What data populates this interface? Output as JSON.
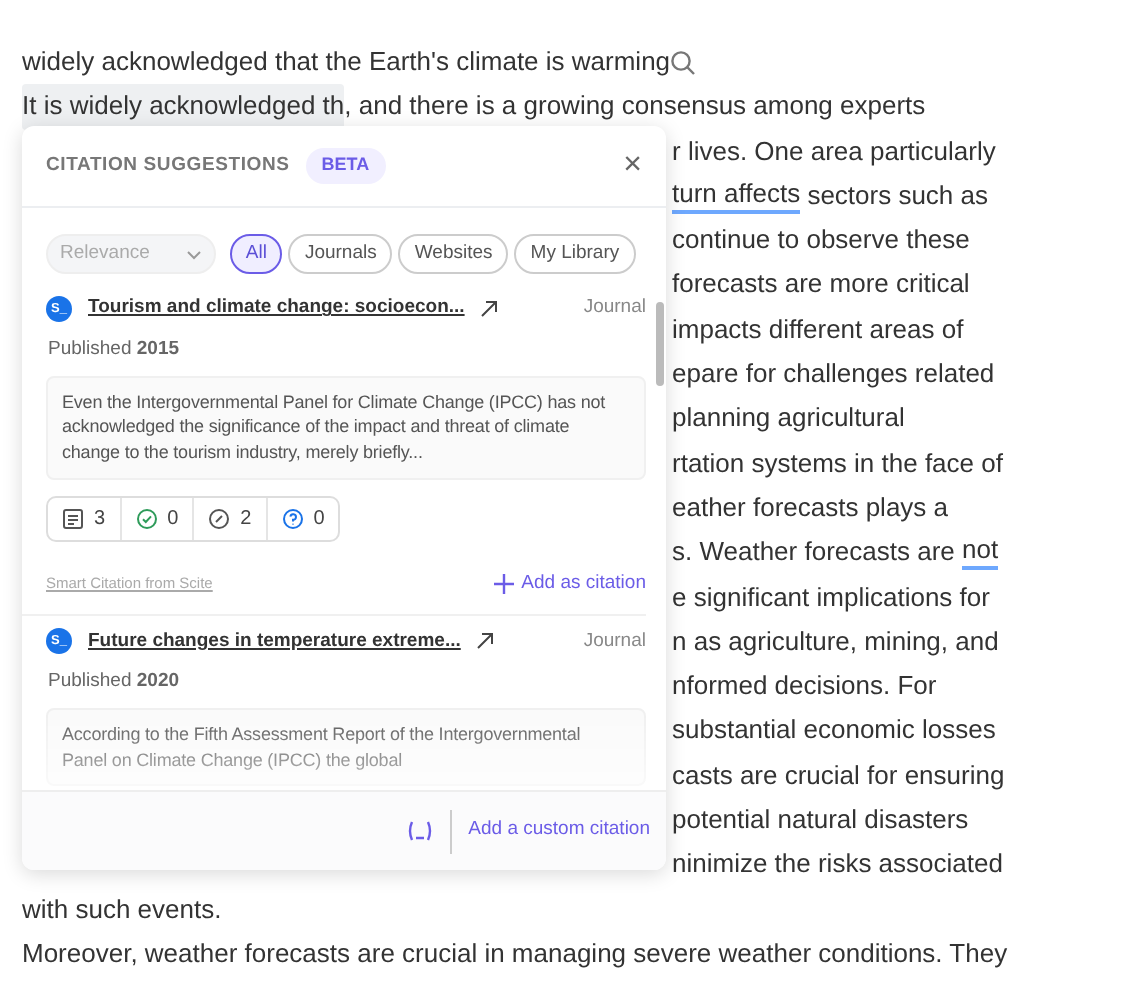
{
  "document": {
    "top_lines": [
      {
        "search_icon": true,
        "segments": [
          {
            "kind": "plain",
            "text": "widely acknowledged that the Earth's climate is warming"
          }
        ]
      },
      {
        "segments": [
          {
            "kind": "highlighted",
            "text": "It is widely acknowledged th"
          },
          {
            "kind": "plain",
            "text": ", and there is a growing consensus among experts"
          }
        ]
      }
    ],
    "right_fragments": [
      {
        "segments": [
          {
            "kind": "plain",
            "text": "r lives. One area particularly"
          }
        ]
      },
      {
        "segments": [
          {
            "kind": "underlined",
            "text": "turn affects"
          },
          {
            "kind": "plain",
            "text": " sectors such as"
          }
        ]
      },
      {
        "segments": [
          {
            "kind": "plain",
            "text": "continue to observe these"
          }
        ]
      },
      {
        "segments": [
          {
            "kind": "plain",
            "text": "forecasts are more critical"
          }
        ]
      },
      {
        "segments": [
          {
            "kind": "plain",
            "text": "impacts different areas of"
          }
        ]
      },
      {
        "segments": [
          {
            "kind": "plain",
            "text": "epare for challenges related"
          }
        ]
      },
      {
        "segments": [
          {
            "kind": "plain",
            "text": "planning agricultural"
          }
        ]
      },
      {
        "segments": [
          {
            "kind": "plain",
            "text": "rtation systems in the face of"
          }
        ]
      },
      {
        "segments": [
          {
            "kind": "plain",
            "text": "eather forecasts plays a"
          }
        ]
      },
      {
        "segments": [
          {
            "kind": "plain",
            "text": "s. Weather forecasts are "
          },
          {
            "kind": "underlined",
            "text": "not"
          }
        ]
      },
      {
        "segments": [
          {
            "kind": "plain",
            "text": "e significant implications for"
          }
        ]
      },
      {
        "segments": [
          {
            "kind": "plain",
            "text": "n as agriculture, mining, and"
          }
        ]
      },
      {
        "segments": [
          {
            "kind": "plain",
            "text": "nformed decisions. For"
          }
        ]
      },
      {
        "segments": [
          {
            "kind": "plain",
            "text": "substantial economic losses"
          }
        ]
      },
      {
        "segments": [
          {
            "kind": "plain",
            "text": "casts are crucial for ensuring"
          }
        ]
      },
      {
        "segments": [
          {
            "kind": "plain",
            "text": "potential natural disasters"
          }
        ]
      },
      {
        "segments": [
          {
            "kind": "plain",
            "text": "ninimize the risks associated"
          }
        ]
      }
    ],
    "bottom_lines": [
      {
        "segments": [
          {
            "kind": "plain",
            "text": "with such events."
          }
        ]
      },
      {
        "segments": [
          {
            "kind": "plain",
            "text": "Moreover, weather forecasts are crucial in managing severe weather conditions. They"
          }
        ]
      }
    ]
  },
  "popup": {
    "title": "CITATION SUGGESTIONS",
    "badge": "BETA",
    "close": "×",
    "sort": {
      "value": "Relevance"
    },
    "filters": [
      {
        "label": "All",
        "selected": true
      },
      {
        "label": "Journals",
        "selected": false
      },
      {
        "label": "Websites",
        "selected": false
      },
      {
        "label": "My Library",
        "selected": false
      }
    ],
    "results": [
      {
        "source": "S_",
        "title": "Tourism and climate change: socioecon...",
        "type": "Journal",
        "published": "Published **2015**",
        "abstract": "Even the Intergovernmental Panel for Climate Change (IPCC) has not acknowledged the significance of the impact and threat of climate change to the tourism industry, merely briefly...",
        "stats": [
          {
            "kind": "mentions",
            "count": "3"
          },
          {
            "kind": "supporting",
            "count": "0"
          },
          {
            "kind": "contrasting",
            "count": "2"
          },
          {
            "kind": "unknown",
            "count": "0"
          }
        ],
        "credit": "Smart Citation from Scite",
        "action": "Add as citation"
      },
      {
        "source": "S_",
        "title": "Future changes in temperature extreme...",
        "type": "Journal",
        "published": "Published **2020**",
        "abstract": "According to the Fifth Assessment Report of the Intergovernmental Panel on Climate Change (IPCC) the global"
      }
    ],
    "footer": {
      "link": "Add a custom citation"
    }
  }
}
